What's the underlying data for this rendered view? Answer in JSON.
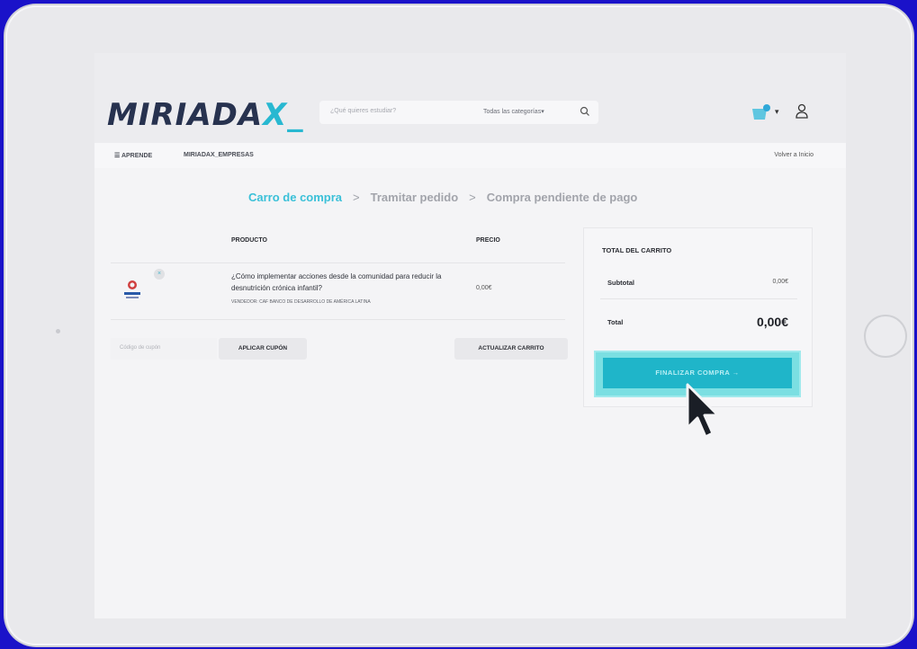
{
  "header": {
    "logo": {
      "main": "MIRIADA",
      "accent": "X_"
    },
    "search": {
      "placeholder": "¿Qué quieres estudiar?",
      "categories": "Todas las categorías",
      "search_icon": "search-icon"
    },
    "icons": [
      "cart-icon",
      "user-icon"
    ]
  },
  "nav": {
    "items": [
      "☰ APRENDE",
      "MIRIADAX_EMPRESAS"
    ],
    "back": "Volver a Inicio"
  },
  "steps": [
    "Carro de compra",
    "Tramitar pedido",
    "Compra pendiente de pago"
  ],
  "cart": {
    "columns": [
      "PRODUCTO",
      "PRECIO"
    ],
    "items": [
      {
        "name": "¿Cómo implementar acciones desde la comunidad para reducir la desnutrición crónica infantil?",
        "vendor": "VENDEDOR: CAF BANCO DE DESARROLLO DE AMÉRICA LATINA",
        "price": "0,00€"
      }
    ],
    "coupon_placeholder": "Código de cupón",
    "apply_coupon": "APLICAR CUPÓN",
    "update_cart": "ACTUALIZAR CARRITO"
  },
  "totals": {
    "title": "TOTAL DEL CARRITO",
    "subtotal_label": "Subtotal",
    "subtotal_value": "0,00€",
    "total_label": "Total",
    "total_value": "0,00€",
    "checkout": "FINALIZAR COMPRA →"
  },
  "colors": {
    "accent": "#1fb5c9",
    "logo_dark": "#27324f",
    "background": "#1a12c9"
  }
}
